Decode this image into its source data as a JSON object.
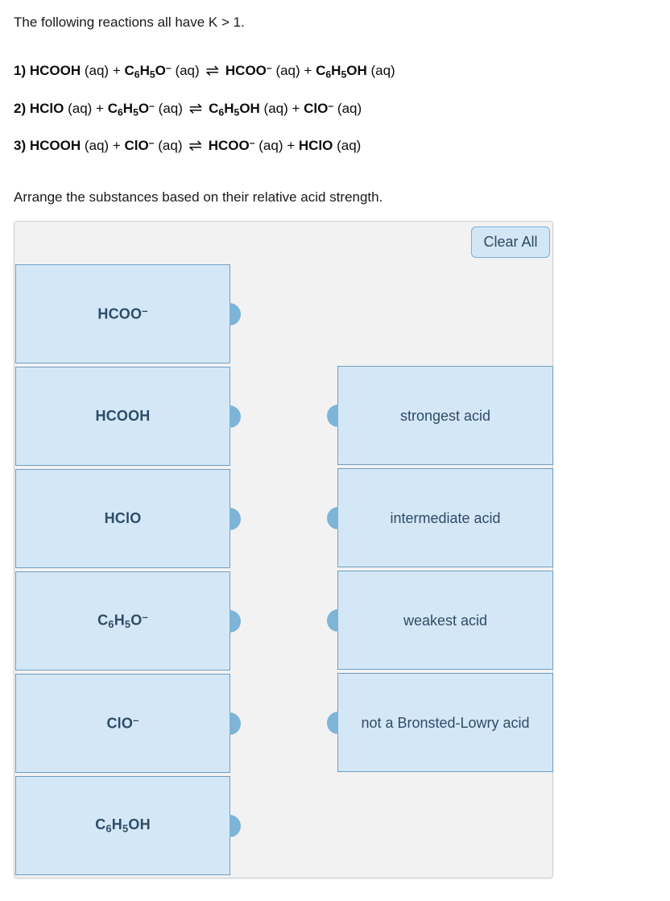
{
  "intro": "The following reactions all have K > 1.",
  "reactions": [
    {
      "number": "1)",
      "parts": [
        {
          "t": "formula",
          "main": "HCOOH"
        },
        {
          "t": "phase",
          "text": " (aq) + "
        },
        {
          "t": "formula",
          "main": "C",
          "sub1": "6",
          "mid": "H",
          "sub2": "5",
          "tail": "O",
          "sup": "–"
        },
        {
          "t": "phase",
          "text": " (aq) "
        },
        {
          "t": "arrow",
          "text": "⇌"
        },
        {
          "t": "phase",
          "text": " "
        },
        {
          "t": "formula",
          "main": "HCOO",
          "sup": "–"
        },
        {
          "t": "phase",
          "text": " (aq) + "
        },
        {
          "t": "formula",
          "main": "C",
          "sub1": "6",
          "mid": "H",
          "sub2": "5",
          "tail": "OH"
        },
        {
          "t": "phase",
          "text": " (aq)"
        }
      ]
    },
    {
      "number": "2)",
      "parts": [
        {
          "t": "formula",
          "main": "HClO"
        },
        {
          "t": "phase",
          "text": " (aq) + "
        },
        {
          "t": "formula",
          "main": "C",
          "sub1": "6",
          "mid": "H",
          "sub2": "5",
          "tail": "O",
          "sup": "–"
        },
        {
          "t": "phase",
          "text": " (aq) "
        },
        {
          "t": "arrow",
          "text": "⇌"
        },
        {
          "t": "phase",
          "text": " "
        },
        {
          "t": "formula",
          "main": "C",
          "sub1": "6",
          "mid": "H",
          "sub2": "5",
          "tail": "OH"
        },
        {
          "t": "phase",
          "text": " (aq) + "
        },
        {
          "t": "formula",
          "main": "ClO",
          "sup": "–"
        },
        {
          "t": "phase",
          "text": " (aq)"
        }
      ]
    },
    {
      "number": "3)",
      "parts": [
        {
          "t": "formula",
          "main": "HCOOH"
        },
        {
          "t": "phase",
          "text": " (aq) + "
        },
        {
          "t": "formula",
          "main": "ClO",
          "sup": "–"
        },
        {
          "t": "phase",
          "text": " (aq) "
        },
        {
          "t": "arrow",
          "text": "⇌"
        },
        {
          "t": "phase",
          "text": " "
        },
        {
          "t": "formula",
          "main": "HCOO",
          "sup": "–"
        },
        {
          "t": "phase",
          "text": " (aq) + "
        },
        {
          "t": "formula",
          "main": "HClO"
        },
        {
          "t": "phase",
          "text": " (aq)"
        }
      ]
    }
  ],
  "instruction": "Arrange the substances based on their relative acid strength.",
  "activity": {
    "clear_all_label": "Clear All",
    "source_tiles": [
      {
        "main": "HCOO",
        "sup": "–",
        "plain": "HCOO–"
      },
      {
        "main": "HCOOH",
        "plain": "HCOOH"
      },
      {
        "main": "HClO",
        "plain": "HClO"
      },
      {
        "main": "C",
        "sub1": "6",
        "mid": "H",
        "sub2": "5",
        "tail": "O",
        "sup": "–",
        "plain": "C6H5O–"
      },
      {
        "main": "ClO",
        "sup": "–",
        "plain": "ClO–"
      },
      {
        "main": "C",
        "sub1": "6",
        "mid": "H",
        "sub2": "5",
        "tail": "OH",
        "plain": "C6H5OH"
      }
    ],
    "target_slots": [
      {
        "label": "strongest acid",
        "filled": false
      },
      {
        "label": "intermediate acid",
        "filled": false
      },
      {
        "label": "weakest acid",
        "filled": false
      },
      {
        "label": "not a Bronsted-Lowry acid",
        "filled": false
      }
    ]
  },
  "colors": {
    "tile_fill": "#d4e7f6",
    "tile_border": "#6e9fc3",
    "tile_text": "#2d4c68",
    "knob": "#7db4d8",
    "container_bg": "#f2f2f2",
    "container_border": "#cfcfcf",
    "button_fill": "#d2e6f6",
    "button_border": "#7fb0d4"
  }
}
